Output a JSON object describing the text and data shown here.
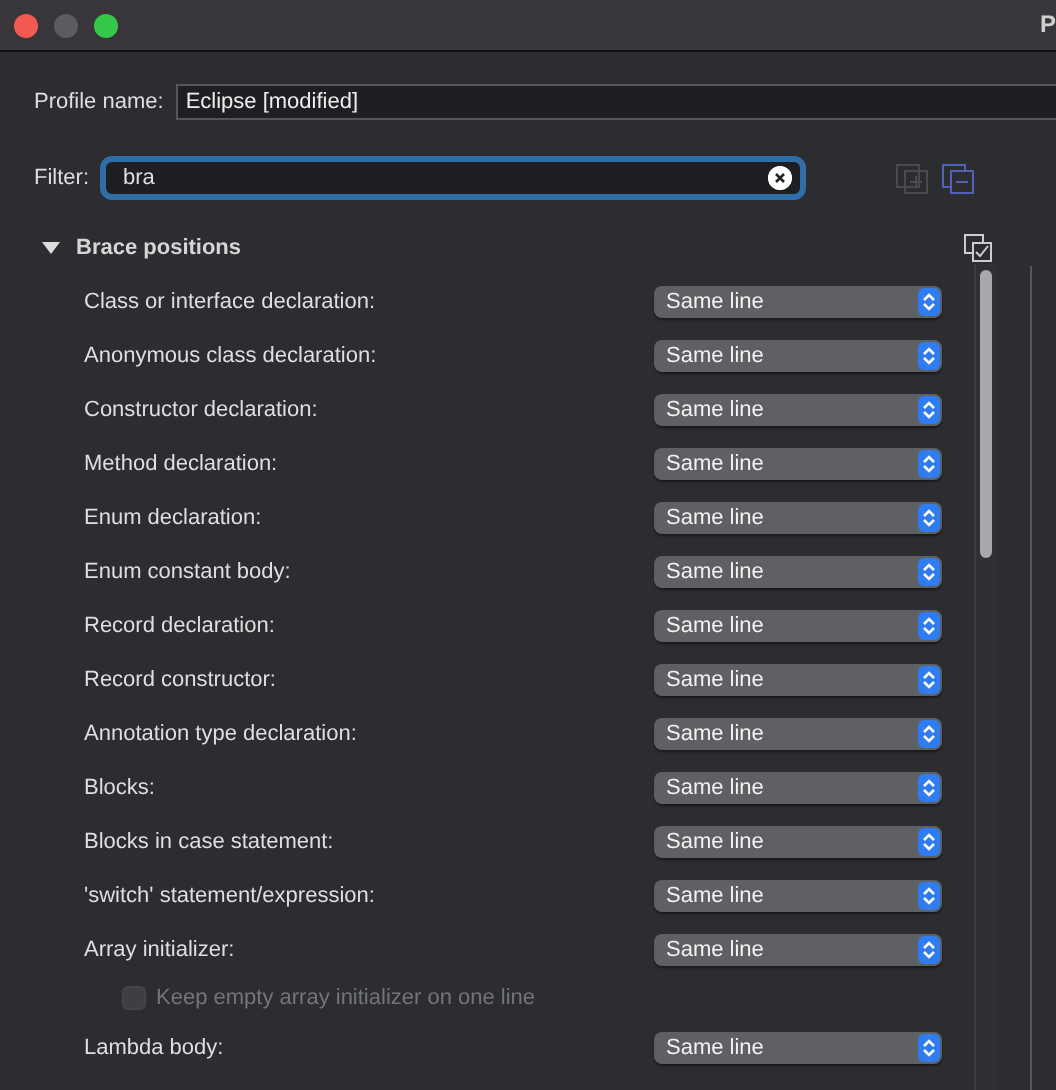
{
  "window": {
    "title": "P"
  },
  "profile": {
    "label": "Profile name:",
    "value": "Eclipse [modified]"
  },
  "filter": {
    "label": "Filter:",
    "value": "bra"
  },
  "section": {
    "title": "Brace positions",
    "expanded": true
  },
  "rows": [
    {
      "kind": "select",
      "label": "Class or interface declaration:",
      "value": "Same line"
    },
    {
      "kind": "select",
      "label": "Anonymous class declaration:",
      "value": "Same line"
    },
    {
      "kind": "select",
      "label": "Constructor declaration:",
      "value": "Same line"
    },
    {
      "kind": "select",
      "label": "Method declaration:",
      "value": "Same line"
    },
    {
      "kind": "select",
      "label": "Enum declaration:",
      "value": "Same line"
    },
    {
      "kind": "select",
      "label": "Enum constant body:",
      "value": "Same line"
    },
    {
      "kind": "select",
      "label": "Record declaration:",
      "value": "Same line"
    },
    {
      "kind": "select",
      "label": "Record constructor:",
      "value": "Same line"
    },
    {
      "kind": "select",
      "label": "Annotation type declaration:",
      "value": "Same line"
    },
    {
      "kind": "select",
      "label": "Blocks:",
      "value": "Same line"
    },
    {
      "kind": "select",
      "label": "Blocks in case statement:",
      "value": "Same line"
    },
    {
      "kind": "select",
      "label": "'switch' statement/expression:",
      "value": "Same line"
    },
    {
      "kind": "select",
      "label": "Array initializer:",
      "value": "Same line"
    },
    {
      "kind": "checkbox",
      "label": "Keep empty array initializer on one line",
      "checked": false,
      "disabled": true
    },
    {
      "kind": "select",
      "label": "Lambda body:",
      "value": "Same line"
    }
  ]
}
